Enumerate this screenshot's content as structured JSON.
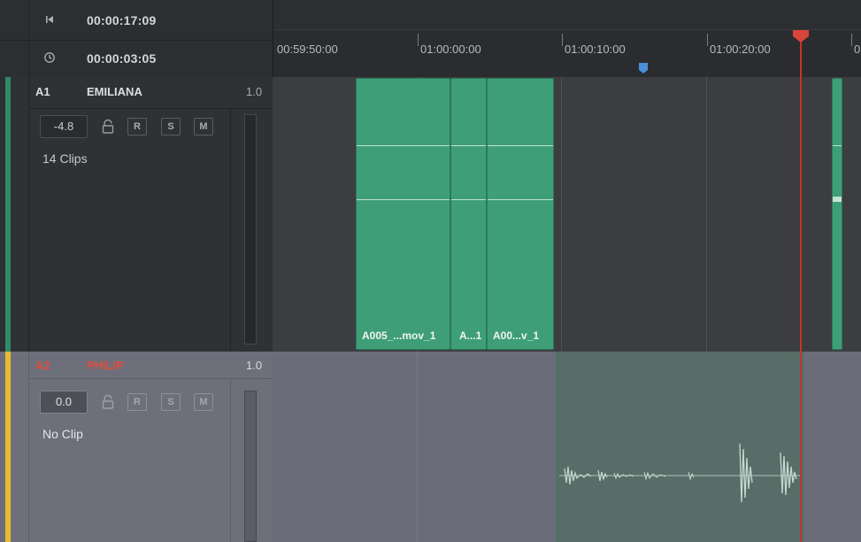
{
  "header": {
    "timecode_top": "00:00:17:09",
    "timecode_bottom": "00:00:03:05",
    "top_icon": "skip-to-start-icon",
    "bottom_icon": "clock-icon"
  },
  "ruler": {
    "labels": [
      "00:59:50:00",
      "01:00:00:00",
      "01:00:10:00",
      "01:00:20:00",
      "0"
    ]
  },
  "tracks": {
    "a1": {
      "id": "A1",
      "name": "EMILIANA",
      "gain": "1.0",
      "volume": "-4.8",
      "buttons": [
        "R",
        "S",
        "M"
      ],
      "clip_count": "14 Clips",
      "color": "#2e8c67",
      "clips": [
        "A005_...mov_1",
        "A...1",
        "A00...v_1"
      ]
    },
    "a2": {
      "id": "A2",
      "name": "PHILIP",
      "gain": "1.0",
      "volume": "0.0",
      "buttons": [
        "R",
        "S",
        "M"
      ],
      "clip_count": "No Clip",
      "color": "#e6bb2e"
    }
  },
  "colors": {
    "playhead": "#c2352a",
    "marker": "#4a8fd8",
    "clip_green": "#3e9e77",
    "track_name_alert": "#e04b3f"
  }
}
